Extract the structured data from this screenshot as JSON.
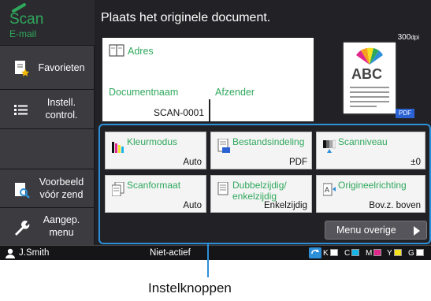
{
  "mode": {
    "title": "Scan",
    "subtitle": "E-mail"
  },
  "sidebar": {
    "items": [
      {
        "label": "Favorieten",
        "icon": "star-document-icon"
      },
      {
        "label": "Instell. control.",
        "icon": "list-icon"
      },
      {
        "label": "Voorbeeld vóór zend",
        "icon": "preview-magnifier-icon"
      },
      {
        "label": "Aangep. menu",
        "icon": "wrench-icon"
      }
    ]
  },
  "header": {
    "message": "Plaats het originele document."
  },
  "address": {
    "label": "Adres"
  },
  "document": {
    "name_label": "Documentnaam",
    "name_value": "SCAN-0001",
    "sender_label": "Afzender"
  },
  "preview": {
    "dpi": "300",
    "dpi_unit": "dpi",
    "doc_text": "ABC",
    "format_badge": "PDF"
  },
  "settings": [
    {
      "title": "Kleurmodus",
      "value": "Auto",
      "icon": "color-mode-icon"
    },
    {
      "title": "Bestandsindeling",
      "value": "PDF",
      "icon": "file-format-icon"
    },
    {
      "title": "Scanniveau",
      "value": "±0",
      "icon": "scan-level-icon"
    },
    {
      "title": "Scanformaat",
      "value": "Auto",
      "icon": "scan-size-icon"
    },
    {
      "title": "Dubbelzijdig/ enkelzijdig",
      "value": "Enkelzijdig",
      "icon": "duplex-icon"
    },
    {
      "title": "Origineelrichting",
      "value": "Bov.z. boven",
      "icon": "orientation-icon"
    }
  ],
  "more_menu": {
    "label": "Menu overige"
  },
  "status": {
    "user": "J.Smith",
    "state": "Niet-actief",
    "toner": [
      {
        "label": "K",
        "color": "#ffffff"
      },
      {
        "label": "C",
        "color": "#19b4e8"
      },
      {
        "label": "M",
        "color": "#e0288c"
      },
      {
        "label": "Y",
        "color": "#f5e21e"
      },
      {
        "label": "G",
        "color": "#ffffff"
      }
    ]
  },
  "callout": {
    "label": "Instelknoppen"
  },
  "colors": {
    "accent_green": "#2fa85c",
    "highlight_blue": "#2d8fd8"
  }
}
